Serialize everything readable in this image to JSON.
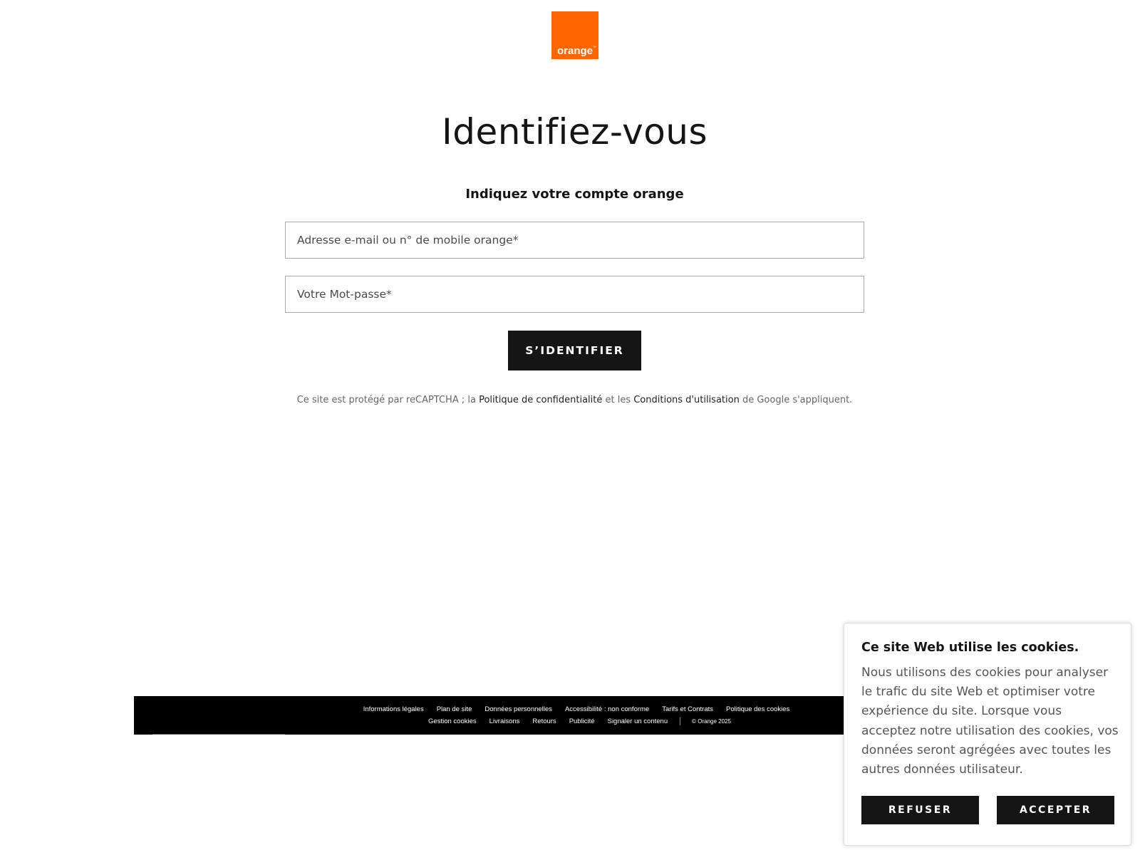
{
  "brand": {
    "logo_text": "orange",
    "logo_tm": "™",
    "logo_color": "#ff6600"
  },
  "login": {
    "title": "Identifiez-vous",
    "subtitle": "Indiquez votre compte orange",
    "email_placeholder": "Adresse e-mail ou n° de mobile orange*",
    "password_placeholder": "Votre Mot-passe*",
    "submit_label": "S’IDENTIFIER"
  },
  "recaptcha": {
    "prefix": "Ce site est protégé par reCAPTCHA ; la ",
    "privacy_link": "Politique de confidentialité",
    "middle": " et les ",
    "terms_link": "Conditions d'utilisation",
    "suffix": " de Google s'appliquent."
  },
  "footer": {
    "row1": [
      "Informations légales",
      "Plan de site",
      "Données personnelles",
      "Accessibilité : non conforme",
      "Tarifs et Contrats",
      "Politique des cookies"
    ],
    "row2": [
      "Gestion cookies",
      "Livraisons",
      "Retours",
      "Publicité",
      "Signaler un contenu"
    ],
    "copyright": "© Orange 2025"
  },
  "cookie_banner": {
    "title": "Ce site Web utilise les cookies.",
    "text": "Nous utilisons des cookies pour analyser le trafic du site Web et optimiser votre expérience du site. Lorsque vous acceptez notre utilisation des cookies, vos données seront agrégées avec toutes les autres données utilisateur.",
    "refuse_label": "REFUSER",
    "accept_label": "ACCEPTER"
  }
}
